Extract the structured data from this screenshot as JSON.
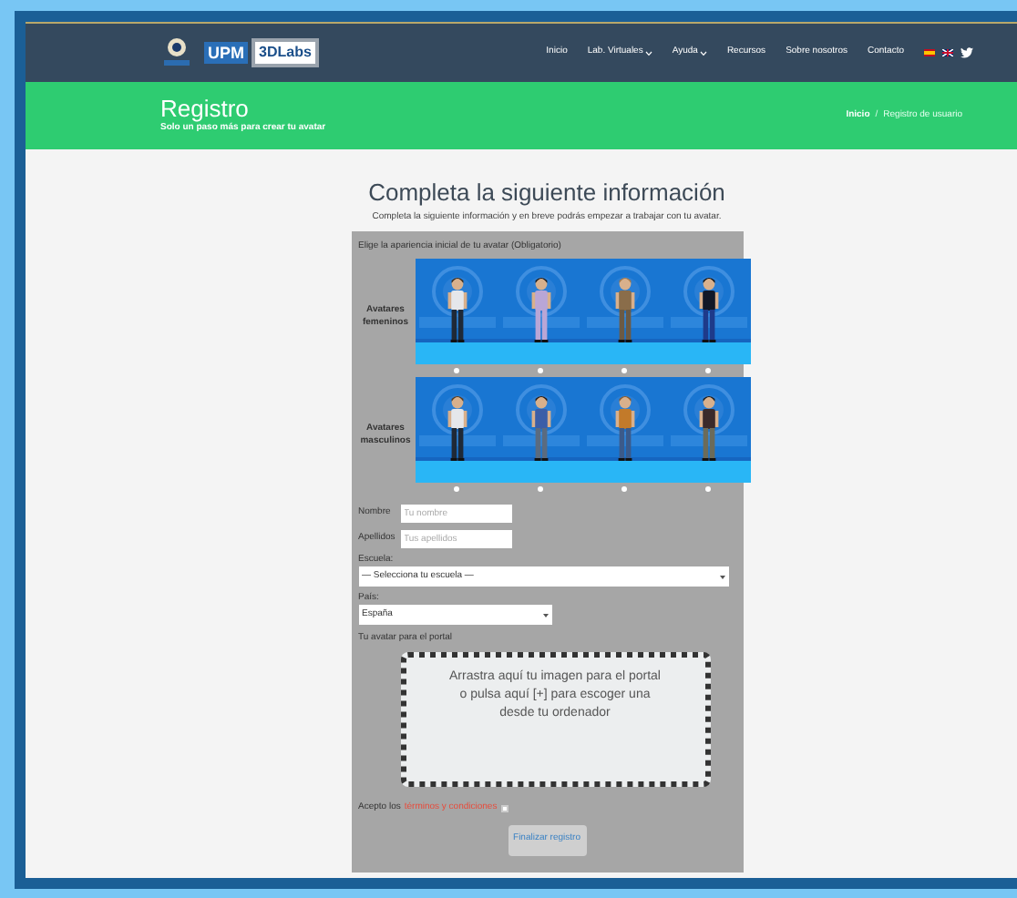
{
  "nav": {
    "logo": {
      "upm": "UPM",
      "labs": "3DLabs"
    },
    "links": [
      {
        "label": "Inicio",
        "dropdown": false
      },
      {
        "label": "Lab. Virtuales",
        "dropdown": true
      },
      {
        "label": "Ayuda",
        "dropdown": true
      },
      {
        "label": "Recursos",
        "dropdown": false
      },
      {
        "label": "Sobre nosotros",
        "dropdown": false
      },
      {
        "label": "Contacto",
        "dropdown": false
      }
    ]
  },
  "header": {
    "title": "Registro",
    "subtitle": "Solo un paso más para crear tu avatar",
    "breadcrumb": [
      "Inicio",
      "Registro de usuario"
    ],
    "breadcrumb_separator": "/"
  },
  "form": {
    "title": "Completa la siguiente información",
    "intro": "Completa la siguiente información y en breve podrás empezar a trabajar con tu avatar.",
    "avatar_prompt": "Elige la apariencia inicial de tu avatar (Obligatorio)",
    "avatar_groups": [
      {
        "label": "Avatares femeninos"
      },
      {
        "label": "Avatares masculinos"
      }
    ],
    "fields": [
      {
        "label": "Nombre",
        "placeholder": "Tu nombre"
      },
      {
        "label": "Apellidos",
        "placeholder": "Tus apellidos"
      }
    ],
    "selects": [
      {
        "label": "Escuela:",
        "value": "— Selecciona tu escuela —"
      },
      {
        "label": "País:",
        "value": "España"
      }
    ],
    "upload": {
      "label": "Tu avatar para el portal",
      "text": "Arrastra aquí tu imagen para el portal o pulsa aquí [+] para escoger una desde tu ordenador"
    },
    "terms": {
      "text": "Acepto los",
      "link": "términos y condiciones",
      "checked": false
    },
    "submit": "Finalizar registro"
  }
}
